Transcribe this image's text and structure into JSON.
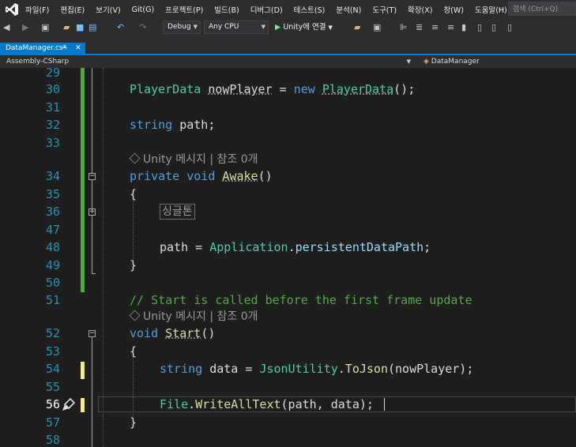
{
  "menubar": {
    "items": [
      "파일(F)",
      "편집(E)",
      "보기(V)",
      "Git(G)",
      "프로젝트(P)",
      "빌드(B)",
      "디버그(D)",
      "테스트(S)",
      "분석(N)",
      "도구(T)",
      "확장(X)",
      "창(W)",
      "도움말(H)"
    ],
    "search_placeholder": "검색 (Ctrl+Q)"
  },
  "toolbar": {
    "config": "Debug",
    "platform": "Any CPU",
    "run_label": "Unity에 연결"
  },
  "tabs": [
    {
      "label": "DataManager.cs*",
      "active": true
    }
  ],
  "navbar": {
    "project": "Assembly-CSharp",
    "class": "DataManager"
  },
  "editor": {
    "current_line": 56,
    "lines": [
      {
        "num": "29",
        "text": ""
      },
      {
        "num": "30",
        "text": "PlayerData nowPlayer = new PlayerData();"
      },
      {
        "num": "31",
        "text": ""
      },
      {
        "num": "32",
        "text": "string path;"
      },
      {
        "num": "33",
        "text": ""
      },
      {
        "num": "34",
        "text": "private void Awake()"
      },
      {
        "num": "35",
        "text": "{"
      },
      {
        "num": "36",
        "text": "싱글톤"
      },
      {
        "num": "47",
        "text": ""
      },
      {
        "num": "48",
        "text": "path = Application.persistentDataPath;"
      },
      {
        "num": "49",
        "text": "}"
      },
      {
        "num": "50",
        "text": ""
      },
      {
        "num": "51",
        "text": "// Start is called before the first frame update"
      },
      {
        "num": "52",
        "text": "void Start()"
      },
      {
        "num": "53",
        "text": "{"
      },
      {
        "num": "54",
        "text": "string data = JsonUtility.ToJson(nowPlayer);"
      },
      {
        "num": "55",
        "text": ""
      },
      {
        "num": "56",
        "text": "File.WriteAllText(path, data);"
      },
      {
        "num": "57",
        "text": "}"
      },
      {
        "num": "58",
        "text": ""
      }
    ],
    "codelens": [
      {
        "label": "Unity 메시지 | 참조 0개"
      },
      {
        "label": "Unity 메시지 | 참조 0개"
      }
    ]
  },
  "colors": {
    "keyword": "#569cd6",
    "type": "#4ec9b0",
    "method": "#dcdcaa",
    "comment": "#57a64a",
    "accent": "#007acc"
  }
}
